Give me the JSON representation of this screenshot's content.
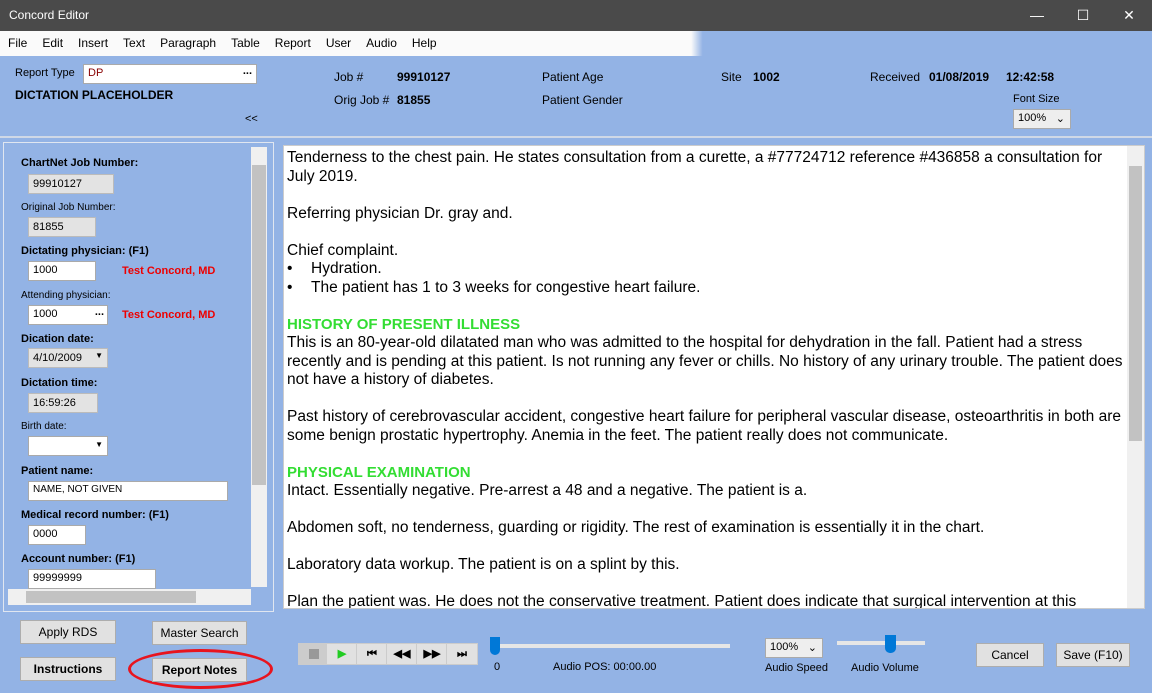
{
  "window": {
    "title": "Concord Editor",
    "minimize": "—",
    "maximize": "☐",
    "close": "✕"
  },
  "menu": [
    "File",
    "Edit",
    "Insert",
    "Text",
    "Paragraph",
    "Table",
    "Report",
    "User",
    "Audio",
    "Help"
  ],
  "header": {
    "report_type_label": "Report Type",
    "report_type_value": "DP",
    "report_type_btn": "...",
    "report_name": "DICTATION PLACEHOLDER",
    "collapse": "<<",
    "job_label": "Job #",
    "job_value": "99910127",
    "orig_job_label": "Orig Job #",
    "orig_job_value": "81855",
    "patient_age_label": "Patient Age",
    "patient_gender_label": "Patient Gender",
    "site_label": "Site",
    "site_value": "1002",
    "received_label": "Received",
    "received_date": "01/08/2019",
    "received_time": "12:42:58",
    "font_size_label": "Font Size",
    "font_size_value": "100%"
  },
  "left": {
    "chartnet_label": "ChartNet Job Number:",
    "chartnet_value": "99910127",
    "orig_label": "Original Job Number:",
    "orig_value": "81855",
    "dictating_label": "Dictating physician: (F1)",
    "dictating_value": "1000",
    "dictating_name": "Test Concord, MD",
    "attending_label": "Attending physician:",
    "attending_value": "1000",
    "attending_name": "Test Concord, MD",
    "attending_btn": "...",
    "dict_date_label": "Dication date:",
    "dict_date_value": "4/10/2009",
    "dict_time_label": "Dictation time:",
    "dict_time_value": "16:59:26",
    "birth_label": "Birth date:",
    "birth_value": "",
    "patient_label": "Patient name:",
    "patient_value": "NAME, NOT GIVEN",
    "mrn_label": "Medical record number: (F1)",
    "mrn_value": "0000",
    "account_label": "Account number: (F1)",
    "account_value": "99999999"
  },
  "editor": {
    "p1": "Tenderness to the chest pain.  He states consultation from a curette, a #77724712 reference #436858 a consultation for July 2019.",
    "p2": "Referring physician Dr. gray and.",
    "p3": "Chief complaint.",
    "bullets": [
      "Hydration.",
      "The patient has 1 to 3 weeks for congestive heart failure."
    ],
    "h1": "HISTORY OF PRESENT ILLNESS",
    "p4": "This is an 80-year-old dilatated man who was admitted to the hospital for dehydration in the fall.  Patient had a stress recently and is pending at this patient.  Is not running any fever or chills.  No history of any urinary trouble.  The patient does not have a history of diabetes.",
    "p5": "Past history of cerebrovascular accident, congestive heart failure for peripheral vascular disease, osteoarthritis in both are some benign prostatic hypertrophy.  Anemia in the feet.  The patient really does not communicate.",
    "h2": "PHYSICAL EXAMINATION",
    "p6": "Intact.  Essentially negative.  Pre-arrest a 48 and a negative.  The patient is a.",
    "p7": "Abdomen soft, no tenderness, guarding or rigidity.  The rest of examination is essentially it in the chart.",
    "p8": "Laboratory data workup.  The patient is on a splint by this.",
    "p9": "Plan the patient was.  He does not the conservative treatment.  Patient does indicate that surgical intervention at this"
  },
  "bottom": {
    "apply_rds": "Apply RDS",
    "master_search": "Master Search",
    "instructions": "Instructions",
    "report_notes": "Report Notes",
    "audio_pos_value": "0",
    "audio_pos_label": "Audio POS: 00:00.00",
    "audio_speed_value": "100%",
    "audio_speed_label": "Audio Speed",
    "audio_volume_label": "Audio Volume",
    "audio_volume_level": 0.6,
    "cancel": "Cancel",
    "save": "Save (F10)"
  },
  "colors": {
    "background": "#93b3e5",
    "heading": "#33dd33",
    "physician": "#ee0000",
    "highlight_ring": "#e8141e",
    "play": "#22cc22"
  }
}
